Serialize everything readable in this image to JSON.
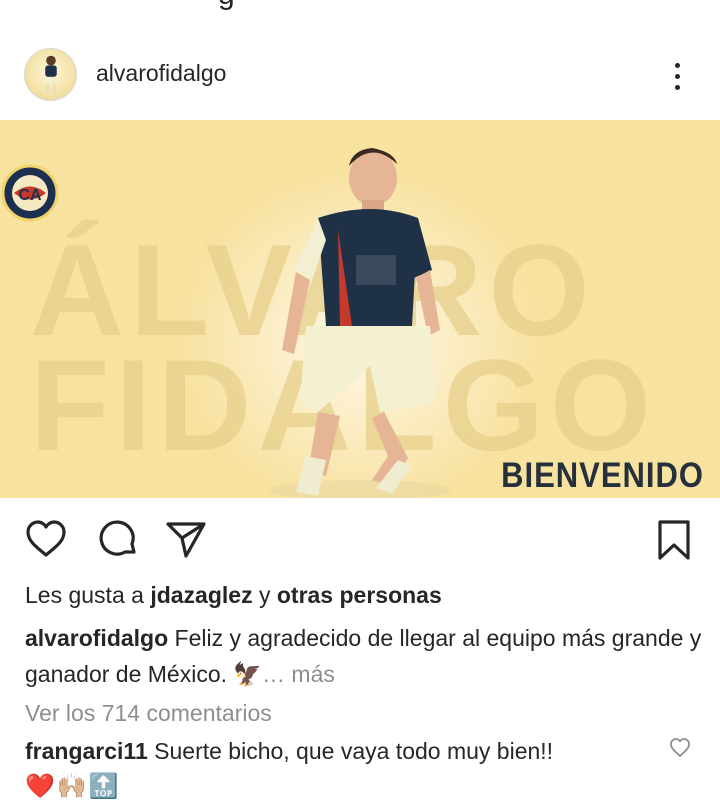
{
  "post": {
    "username": "alvarofidalgo",
    "image_headline": "BIENVENIDO",
    "image_big_text": [
      "ÁLVARO",
      "FIDALGO"
    ],
    "likes_prefix": "Les gusta a",
    "likes_user": "jdazaglez",
    "likes_connector": "y",
    "likes_others": "otras personas",
    "caption_user": "alvarofidalgo",
    "caption_text": "Feliz y agradecido de llegar al equipo más grande y ganador de México. 🦅",
    "caption_more": "… más",
    "view_comments": "Ver los 714 comentarios"
  },
  "comment": {
    "user": "frangarci11",
    "text": "Suerte bicho, que vaya todo muy bien!!",
    "emojis": [
      "❤️",
      "🙌🏼",
      "🔝"
    ]
  },
  "icons": {
    "more": "more-vertical-icon",
    "like": "heart-icon",
    "comment": "comment-icon",
    "share": "send-icon",
    "save": "bookmark-icon",
    "comment_like": "heart-small-icon"
  },
  "colors": {
    "text": "#262626",
    "muted": "#8e8e8e",
    "banner_bg": "#f8e2a0",
    "headline": "#26303c"
  }
}
